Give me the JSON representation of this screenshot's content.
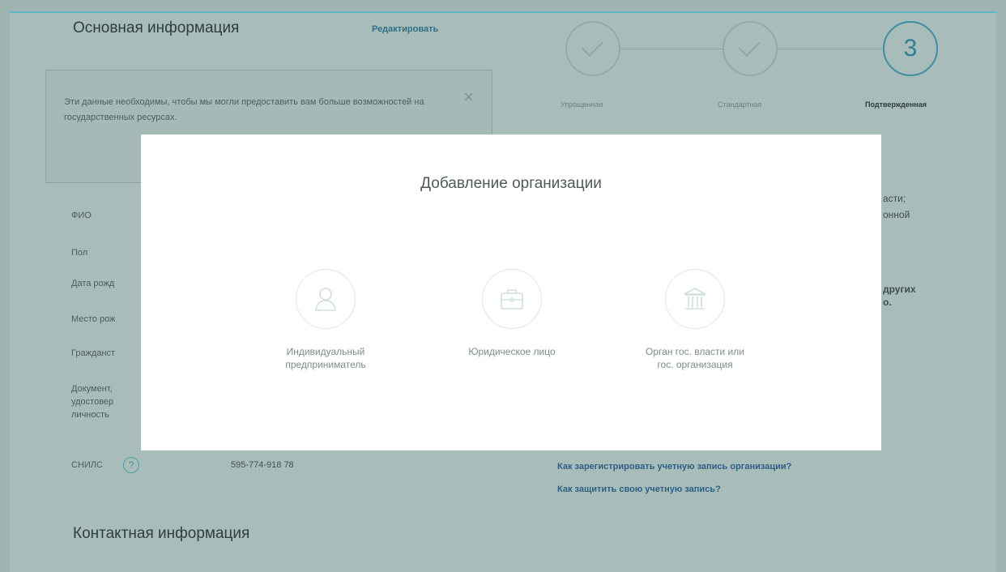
{
  "main": {
    "section_title": "Основная информация",
    "edit_link": "Редактировать",
    "notice_text": "Эти данные необходимы, чтобы мы могли предоставить вам больше возможностей на государственных ресурсах.",
    "notice_close": "×",
    "fields": {
      "fio": "ФИО",
      "gender": "Пол",
      "birth_date": "Дата рожд",
      "birth_place": "Место рож",
      "citizenship": "Гражданст",
      "document_line1": "Документ,",
      "document_line2": "удостовер",
      "document_line3": "личность"
    },
    "snils_label": "СНИЛС",
    "snils_help": "?",
    "snils_value": "595-774-918 78",
    "contact_title": "Контактная информация"
  },
  "steps": {
    "step3_number": "3",
    "labels": [
      "Упрощенная",
      "Стандартная",
      "Подтвержденная"
    ]
  },
  "side": {
    "fragment1": "асти;",
    "fragment2": "онной",
    "fragment3": "других",
    "fragment4": "о.",
    "help_links": [
      "Как зарегистрировать учетную запись организации?",
      "Как защитить свою учетную запись?"
    ]
  },
  "modal": {
    "title": "Добавление организации",
    "options": [
      {
        "label": "Индивидуальный\nпредприниматель",
        "icon": "person-icon"
      },
      {
        "label": "Юридическое лицо",
        "icon": "briefcase-icon"
      },
      {
        "label": "Орган гос. власти или\nгос. организация",
        "icon": "government-building-icon"
      }
    ]
  },
  "colors": {
    "overlay": "#a8bdb9",
    "accent": "#3d8ea3",
    "modal_bg": "#ffffff"
  }
}
